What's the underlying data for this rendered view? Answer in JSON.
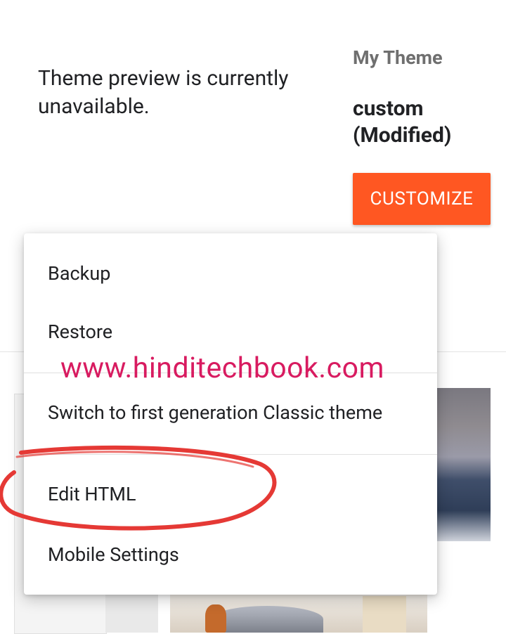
{
  "preview": {
    "message": "Theme preview is currently unavailable."
  },
  "theme": {
    "label": "My Theme",
    "name": "custom (Modified)",
    "customize_label": "CUSTOMIZE"
  },
  "menu": {
    "items": [
      {
        "label": "Backup"
      },
      {
        "label": "Restore"
      },
      {
        "label": "Switch to first generation Classic theme"
      },
      {
        "label": "Edit HTML"
      },
      {
        "label": "Mobile Settings"
      }
    ]
  },
  "watermark": {
    "text": "www.hinditechbook.com",
    "color": "#d81b60"
  },
  "colors": {
    "accent": "#ff5722",
    "annotation": "#e53935"
  }
}
